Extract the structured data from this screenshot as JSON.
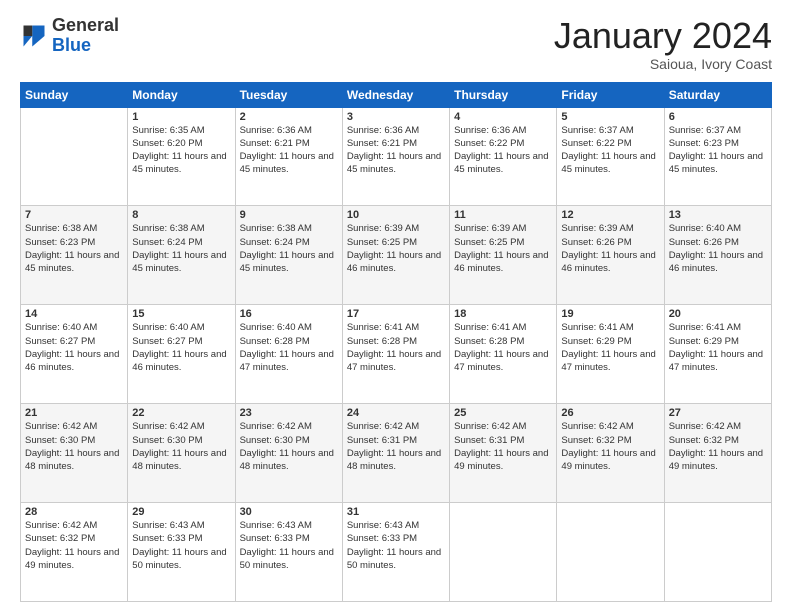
{
  "header": {
    "logo": {
      "general": "General",
      "blue": "Blue"
    },
    "title": "January 2024",
    "subtitle": "Saioua, Ivory Coast"
  },
  "calendar": {
    "days_of_week": [
      "Sunday",
      "Monday",
      "Tuesday",
      "Wednesday",
      "Thursday",
      "Friday",
      "Saturday"
    ],
    "weeks": [
      [
        {
          "day": "",
          "sunrise": "",
          "sunset": "",
          "daylight": ""
        },
        {
          "day": "1",
          "sunrise": "Sunrise: 6:35 AM",
          "sunset": "Sunset: 6:20 PM",
          "daylight": "Daylight: 11 hours and 45 minutes."
        },
        {
          "day": "2",
          "sunrise": "Sunrise: 6:36 AM",
          "sunset": "Sunset: 6:21 PM",
          "daylight": "Daylight: 11 hours and 45 minutes."
        },
        {
          "day": "3",
          "sunrise": "Sunrise: 6:36 AM",
          "sunset": "Sunset: 6:21 PM",
          "daylight": "Daylight: 11 hours and 45 minutes."
        },
        {
          "day": "4",
          "sunrise": "Sunrise: 6:36 AM",
          "sunset": "Sunset: 6:22 PM",
          "daylight": "Daylight: 11 hours and 45 minutes."
        },
        {
          "day": "5",
          "sunrise": "Sunrise: 6:37 AM",
          "sunset": "Sunset: 6:22 PM",
          "daylight": "Daylight: 11 hours and 45 minutes."
        },
        {
          "day": "6",
          "sunrise": "Sunrise: 6:37 AM",
          "sunset": "Sunset: 6:23 PM",
          "daylight": "Daylight: 11 hours and 45 minutes."
        }
      ],
      [
        {
          "day": "7",
          "sunrise": "Sunrise: 6:38 AM",
          "sunset": "Sunset: 6:23 PM",
          "daylight": "Daylight: 11 hours and 45 minutes."
        },
        {
          "day": "8",
          "sunrise": "Sunrise: 6:38 AM",
          "sunset": "Sunset: 6:24 PM",
          "daylight": "Daylight: 11 hours and 45 minutes."
        },
        {
          "day": "9",
          "sunrise": "Sunrise: 6:38 AM",
          "sunset": "Sunset: 6:24 PM",
          "daylight": "Daylight: 11 hours and 45 minutes."
        },
        {
          "day": "10",
          "sunrise": "Sunrise: 6:39 AM",
          "sunset": "Sunset: 6:25 PM",
          "daylight": "Daylight: 11 hours and 46 minutes."
        },
        {
          "day": "11",
          "sunrise": "Sunrise: 6:39 AM",
          "sunset": "Sunset: 6:25 PM",
          "daylight": "Daylight: 11 hours and 46 minutes."
        },
        {
          "day": "12",
          "sunrise": "Sunrise: 6:39 AM",
          "sunset": "Sunset: 6:26 PM",
          "daylight": "Daylight: 11 hours and 46 minutes."
        },
        {
          "day": "13",
          "sunrise": "Sunrise: 6:40 AM",
          "sunset": "Sunset: 6:26 PM",
          "daylight": "Daylight: 11 hours and 46 minutes."
        }
      ],
      [
        {
          "day": "14",
          "sunrise": "Sunrise: 6:40 AM",
          "sunset": "Sunset: 6:27 PM",
          "daylight": "Daylight: 11 hours and 46 minutes."
        },
        {
          "day": "15",
          "sunrise": "Sunrise: 6:40 AM",
          "sunset": "Sunset: 6:27 PM",
          "daylight": "Daylight: 11 hours and 46 minutes."
        },
        {
          "day": "16",
          "sunrise": "Sunrise: 6:40 AM",
          "sunset": "Sunset: 6:28 PM",
          "daylight": "Daylight: 11 hours and 47 minutes."
        },
        {
          "day": "17",
          "sunrise": "Sunrise: 6:41 AM",
          "sunset": "Sunset: 6:28 PM",
          "daylight": "Daylight: 11 hours and 47 minutes."
        },
        {
          "day": "18",
          "sunrise": "Sunrise: 6:41 AM",
          "sunset": "Sunset: 6:28 PM",
          "daylight": "Daylight: 11 hours and 47 minutes."
        },
        {
          "day": "19",
          "sunrise": "Sunrise: 6:41 AM",
          "sunset": "Sunset: 6:29 PM",
          "daylight": "Daylight: 11 hours and 47 minutes."
        },
        {
          "day": "20",
          "sunrise": "Sunrise: 6:41 AM",
          "sunset": "Sunset: 6:29 PM",
          "daylight": "Daylight: 11 hours and 47 minutes."
        }
      ],
      [
        {
          "day": "21",
          "sunrise": "Sunrise: 6:42 AM",
          "sunset": "Sunset: 6:30 PM",
          "daylight": "Daylight: 11 hours and 48 minutes."
        },
        {
          "day": "22",
          "sunrise": "Sunrise: 6:42 AM",
          "sunset": "Sunset: 6:30 PM",
          "daylight": "Daylight: 11 hours and 48 minutes."
        },
        {
          "day": "23",
          "sunrise": "Sunrise: 6:42 AM",
          "sunset": "Sunset: 6:30 PM",
          "daylight": "Daylight: 11 hours and 48 minutes."
        },
        {
          "day": "24",
          "sunrise": "Sunrise: 6:42 AM",
          "sunset": "Sunset: 6:31 PM",
          "daylight": "Daylight: 11 hours and 48 minutes."
        },
        {
          "day": "25",
          "sunrise": "Sunrise: 6:42 AM",
          "sunset": "Sunset: 6:31 PM",
          "daylight": "Daylight: 11 hours and 49 minutes."
        },
        {
          "day": "26",
          "sunrise": "Sunrise: 6:42 AM",
          "sunset": "Sunset: 6:32 PM",
          "daylight": "Daylight: 11 hours and 49 minutes."
        },
        {
          "day": "27",
          "sunrise": "Sunrise: 6:42 AM",
          "sunset": "Sunset: 6:32 PM",
          "daylight": "Daylight: 11 hours and 49 minutes."
        }
      ],
      [
        {
          "day": "28",
          "sunrise": "Sunrise: 6:42 AM",
          "sunset": "Sunset: 6:32 PM",
          "daylight": "Daylight: 11 hours and 49 minutes."
        },
        {
          "day": "29",
          "sunrise": "Sunrise: 6:43 AM",
          "sunset": "Sunset: 6:33 PM",
          "daylight": "Daylight: 11 hours and 50 minutes."
        },
        {
          "day": "30",
          "sunrise": "Sunrise: 6:43 AM",
          "sunset": "Sunset: 6:33 PM",
          "daylight": "Daylight: 11 hours and 50 minutes."
        },
        {
          "day": "31",
          "sunrise": "Sunrise: 6:43 AM",
          "sunset": "Sunset: 6:33 PM",
          "daylight": "Daylight: 11 hours and 50 minutes."
        },
        {
          "day": "",
          "sunrise": "",
          "sunset": "",
          "daylight": ""
        },
        {
          "day": "",
          "sunrise": "",
          "sunset": "",
          "daylight": ""
        },
        {
          "day": "",
          "sunrise": "",
          "sunset": "",
          "daylight": ""
        }
      ]
    ]
  }
}
